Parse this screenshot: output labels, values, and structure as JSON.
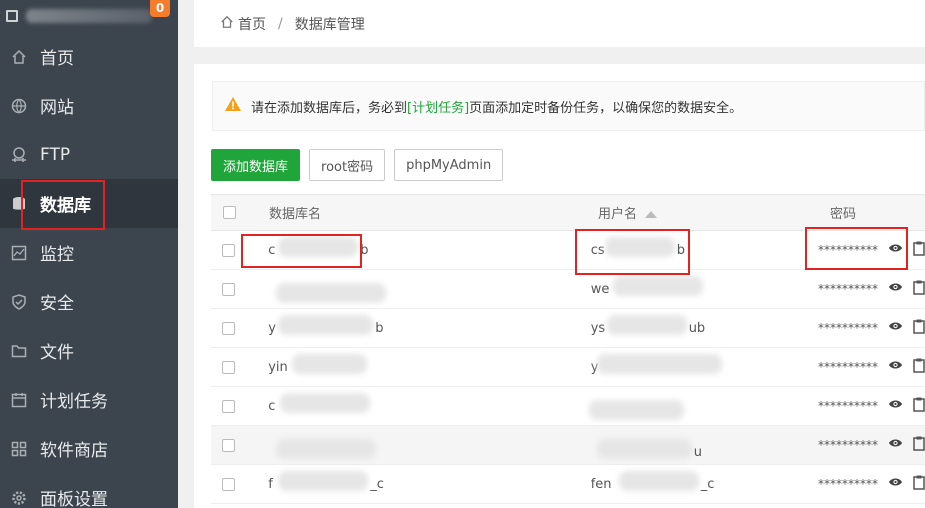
{
  "sidebar": {
    "badge": "0",
    "items": [
      {
        "label": "首页",
        "icon": "home-icon"
      },
      {
        "label": "网站",
        "icon": "globe-icon"
      },
      {
        "label": "FTP",
        "icon": "ftp-icon"
      },
      {
        "label": "数据库",
        "icon": "database-icon"
      },
      {
        "label": "监控",
        "icon": "monitor-icon"
      },
      {
        "label": "安全",
        "icon": "shield-icon"
      },
      {
        "label": "文件",
        "icon": "folder-icon"
      },
      {
        "label": "计划任务",
        "icon": "calendar-icon"
      },
      {
        "label": "软件商店",
        "icon": "grid-icon"
      },
      {
        "label": "面板设置",
        "icon": "gear-icon"
      }
    ],
    "active_index": 3
  },
  "breadcrumb": {
    "home": "首页",
    "separator": "/",
    "current": "数据库管理"
  },
  "alert": {
    "before": "请在添加数据库后，务必到",
    "link": "[计划任务]",
    "after": "页面添加定时备份任务，以确保您的数据安全。"
  },
  "buttons": {
    "add": "添加数据库",
    "root": "root密码",
    "pma": "phpMyAdmin"
  },
  "table": {
    "headers": {
      "name": "数据库名",
      "user": "用户名",
      "password": "密码"
    },
    "rows": [
      {
        "name": "c",
        "name_tail": "b",
        "user": "cs",
        "user_tail": "b",
        "password": "**********"
      },
      {
        "name": "",
        "name_tail": "",
        "user": "we",
        "user_tail": "",
        "password": "**********"
      },
      {
        "name": "y",
        "name_tail": "b",
        "user": "ys",
        "user_tail": "ub",
        "password": "**********"
      },
      {
        "name": "yin",
        "name_tail": "",
        "user": "y",
        "user_tail": "",
        "password": "**********"
      },
      {
        "name": "c",
        "name_tail": "",
        "user": "",
        "user_tail": "",
        "password": "**********"
      },
      {
        "name": "",
        "name_tail": "",
        "user": "",
        "user_tail": "u",
        "password": "**********"
      },
      {
        "name": "f",
        "name_tail": "_c",
        "user": "fen",
        "user_tail": "_c",
        "password": "**********"
      }
    ]
  }
}
